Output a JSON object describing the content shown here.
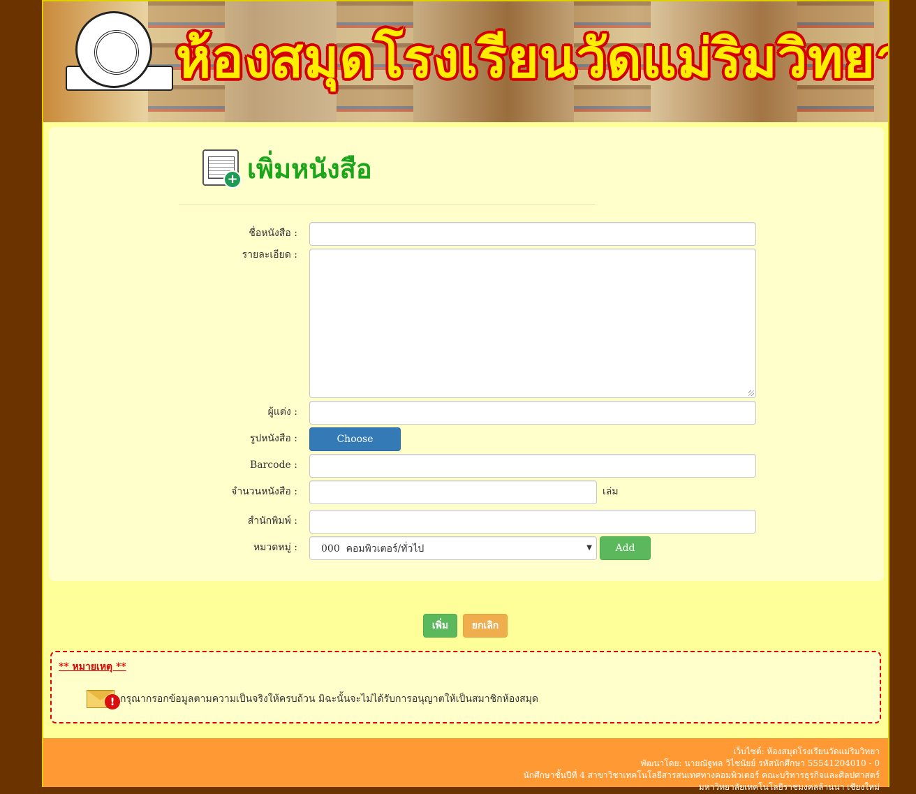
{
  "banner": {
    "title": "ห้องสมุดโรงเรียนวัดแม่ริมวิทยา"
  },
  "page": {
    "heading": "เพิ่มหนังสือ"
  },
  "form": {
    "book_name_label": "ชื่อหนังสือ :",
    "book_name_value": "",
    "details_label": "รายละเอียด :",
    "details_value": "",
    "author_label": "ผู้แต่ง :",
    "author_value": "",
    "cover_label": "รูปหนังสือ :",
    "choose_picture_label": "Choose Picture.....",
    "barcode_label": "Barcode :",
    "barcode_value": "",
    "quantity_label": "จำนวนหนังสือ :",
    "quantity_value": "",
    "quantity_unit": "เล่ม",
    "publisher_label": "สำนักพิมพ์ :",
    "publisher_value": "",
    "category_label": "หมวดหมู่ :",
    "category_selected": "000  คอมพิวเตอร์/ทั่วไป",
    "add_category_label": "Add"
  },
  "actions": {
    "submit_label": "เพิ่ม",
    "cancel_label": "ยกเลิก"
  },
  "note": {
    "title": "** หมายเหตุ **",
    "text": "กรุณากรอกข้อมูลตามความเป็นจริงให้ครบถ้วน มิฉะนั้นจะไม่ได้รับการอนุญาตให้เป็นสมาชิกห้องสมุด"
  },
  "footer": {
    "line1": "เว็บไซต์: ห้องสมุดโรงเรียนวัดแม่ริมวิทยา",
    "line2": "พัฒนาโดย: นายณัฐพล วิไชนัยย์ รหัสนักศึกษา 55541204010 - 0",
    "line3": "นักศึกษาชั้นปีที่ 4 สาขาวิชาเทคโนโลยีสารสนเทศทางคอมพิวเตอร์ คณะบริหารธุรกิจและศิลปศาสตร์",
    "line4": "มหาวิทยาลัยเทคโนโลยีราชมงคลล้านนา เชียงใหม่"
  },
  "colors": {
    "page_bg": "#6b3300",
    "content_bg": "#ffff99",
    "panel_bg": "#ffffcc",
    "heading_green": "#1aa51a",
    "primary_blue": "#337ab7",
    "success_green": "#5cb85c",
    "warning_orange": "#f0ad4e",
    "note_red": "#e00000",
    "footer_orange": "#ff9933"
  },
  "icons": {
    "heading": "add-book-icon",
    "note": "mail-warning-icon",
    "select": "caret-down-icon"
  }
}
